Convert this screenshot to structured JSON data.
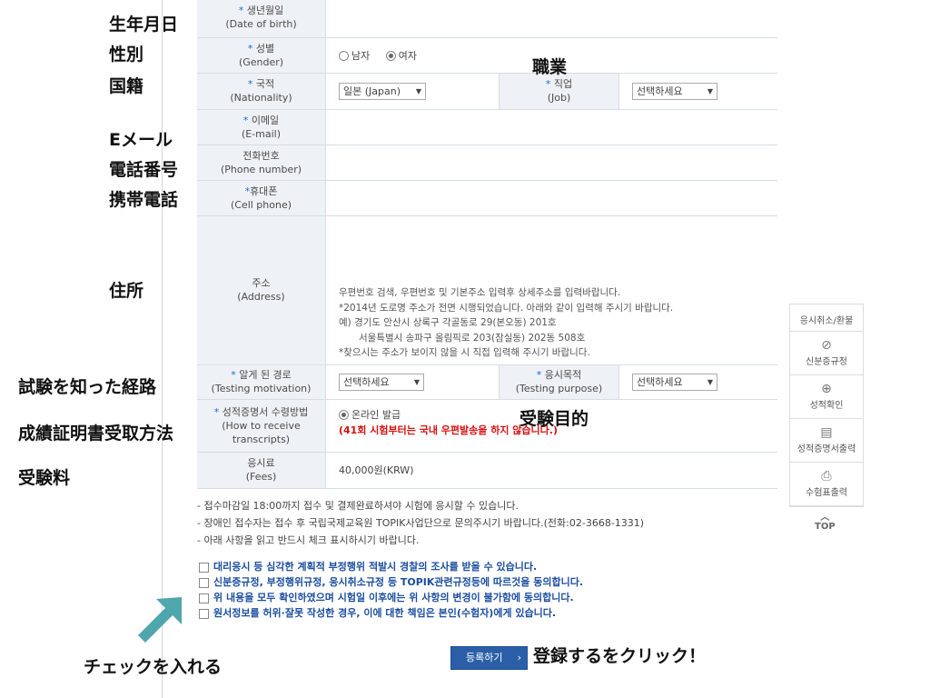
{
  "form": {
    "dob": {
      "label": "생년월일",
      "label_en": "(Date of birth)"
    },
    "gender": {
      "label": "성별",
      "label_en": "(Gender)",
      "options": [
        "남자",
        "여자"
      ],
      "selected": "여자"
    },
    "nationality": {
      "label": "국적",
      "label_en": "(Nationality)",
      "value": "일본 (Japan)"
    },
    "job": {
      "label": "직업",
      "label_en": "(Job)",
      "value": "선택하세요"
    },
    "email": {
      "label": "이메일",
      "label_en": "(E-mail)"
    },
    "phone": {
      "label": "전화번호",
      "label_en": "(Phone number)"
    },
    "cell": {
      "label": "휴대폰",
      "label_en": "(Cell phone)"
    },
    "address": {
      "label": "주소",
      "label_en": "(Address)",
      "help": [
        "우편번호 검색, 우편번호 및 기본주소 입력후 상세주소를 입력바랍니다.",
        "*2014년 도로명 주소가 전면 시행되었습니다. 아래와 같이 입력해 주시기 바랍니다.",
        "예) 경기도 안산시 상록구 각골동로 29(본오동) 201호",
        "서울특별시 송파구 올림픽로 203(잠실동) 202동 508호",
        "*찾으시는 주소가 보이지 않을 시 직접 입력해 주시기 바랍니다."
      ]
    },
    "motivation": {
      "label": "알게 된 경로",
      "label_en": "(Testing motivation)",
      "value": "선택하세요"
    },
    "purpose": {
      "label": "응시목적",
      "label_en": "(Testing purpose)",
      "value": "선택하세요"
    },
    "transcript": {
      "label": "성적증명서 수령방법",
      "label_en1": "(How to receive",
      "label_en2": "transcripts)",
      "option": "온라인 발급",
      "note": "(41회 시험부터는 국내 우편발송을 하지 않습니다.)"
    },
    "fees": {
      "label": "응시료",
      "label_en": "(Fees)",
      "value": "40,000원(KRW)"
    }
  },
  "notes": [
    "- 접수마감일 18:00까지 접수 및 결제완료하셔야 시험에 응시할 수 있습니다.",
    "- 장애인 접수자는 접수 후 국립국제교육원 TOPIK사업단으로 문의주시기 바랍니다.(전화:02-3668-1331)",
    "- 아래 사항을 읽고 반드시 체크 표시하시기 바랍니다."
  ],
  "checks": [
    "대리응시 등 심각한 계획적 부정행위 적발시 경찰의 조사를 받을 수 있습니다.",
    "신분증규정, 부정행위규정, 응시취소규정 등 TOPIK관련규정등에 따르것을 동의합니다.",
    "위 내용을 모두 확인하였으며 시험일 이후에는 위 사항의 변경이 불가함에 동의합니다.",
    "원서정보를 허위·잘못 작성한 경우, 이에 대한 책임은 본인(수험자)에게 있습니다."
  ],
  "submit_label": "등록하기",
  "sidebar": {
    "items": [
      {
        "label": "응시취소/환불",
        "icon": ""
      },
      {
        "label": "신분증규정",
        "icon": "⊘"
      },
      {
        "label": "성적확인",
        "icon": "⊕"
      },
      {
        "label": "성적증명서출력",
        "icon": "▤"
      },
      {
        "label": "수험표출력",
        "icon": "⎙"
      }
    ],
    "top": "TOP"
  },
  "annotations": {
    "dob": "生年月日",
    "gender": "性別",
    "nationality": "国籍",
    "job": "職業",
    "email": "Eメール",
    "phone": "電話番号",
    "cell": "携帯電話",
    "address": "住所",
    "motivation": "試験を知った経路",
    "purpose": "受験目的",
    "transcript": "成績証明書受取方法",
    "fees": "受験料",
    "check": "チェックを入れる",
    "click": "登録するをクリック！"
  },
  "colors": {
    "accent": "#2a5fa8",
    "label_bg": "#eef2f7",
    "arrow": "#4fa6ad"
  }
}
